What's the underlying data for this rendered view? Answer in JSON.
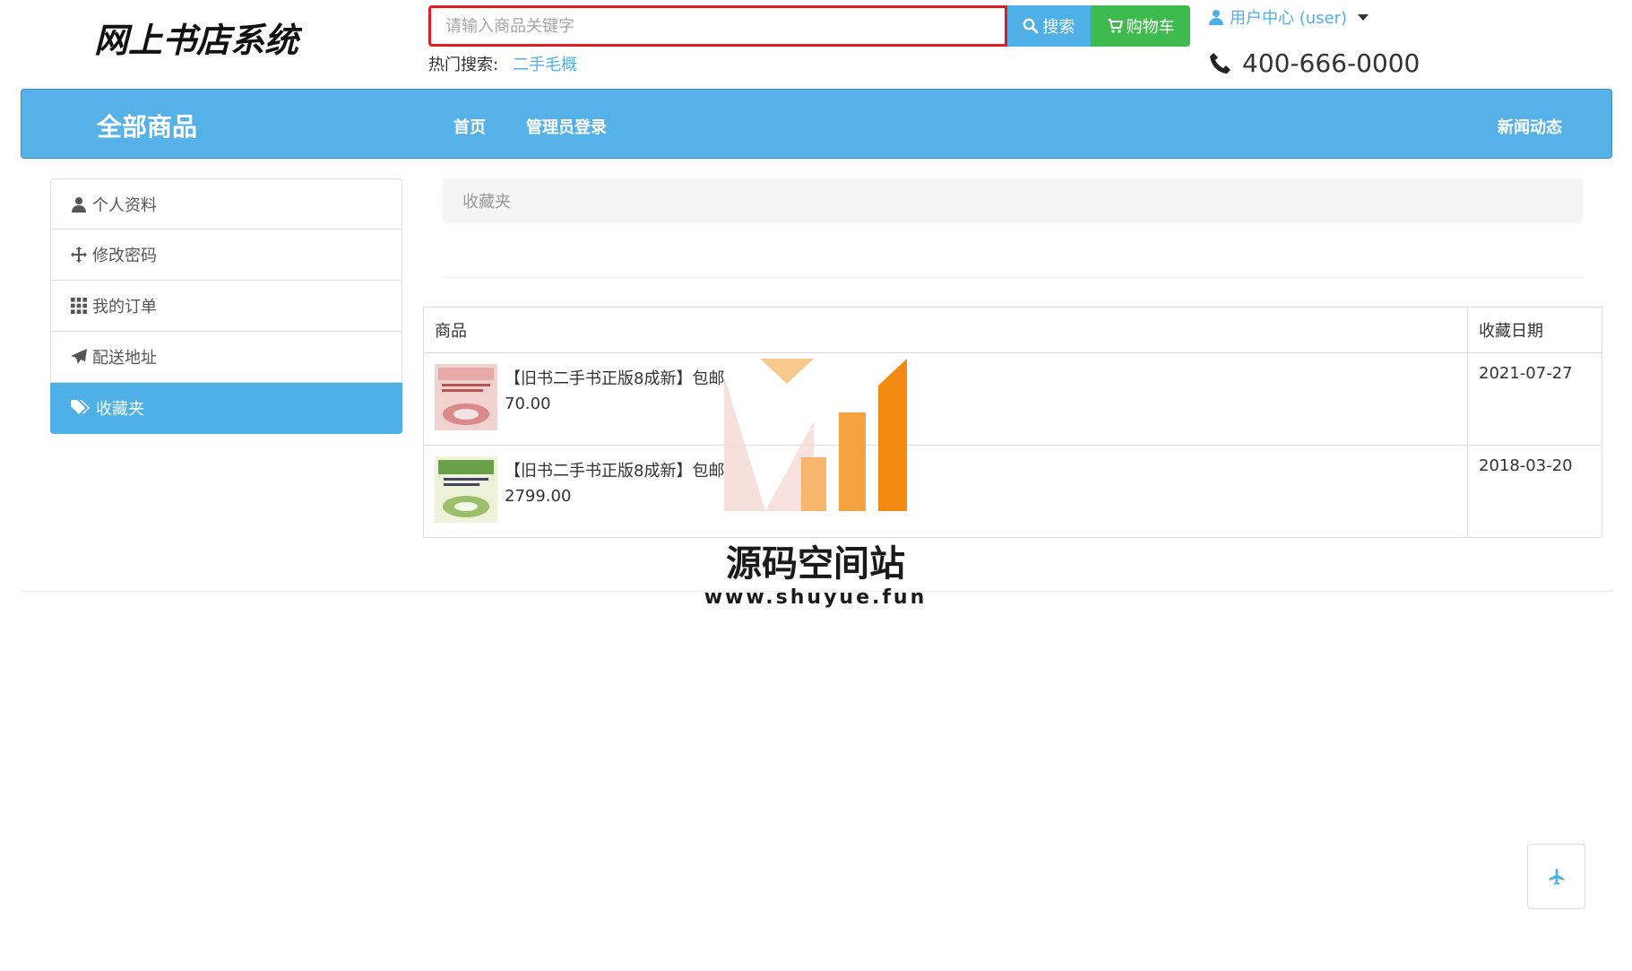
{
  "header": {
    "logo_text": "网上书店系统",
    "search": {
      "placeholder": "请输入商品关键字",
      "value": ""
    },
    "search_button": "搜索",
    "cart_button": "购物车",
    "hot_label": "热门搜索:",
    "hot_links": [
      "二手毛概"
    ],
    "user_center": "用户中心 (user)",
    "phone": "400-666-0000"
  },
  "nav": {
    "all_products": "全部商品",
    "items": [
      "首页",
      "管理员登录"
    ],
    "right_item": "新闻动态"
  },
  "sidebar": {
    "items": [
      {
        "label": "个人资料",
        "icon": "user-icon"
      },
      {
        "label": "修改密码",
        "icon": "move-icon"
      },
      {
        "label": "我的订单",
        "icon": "grid-icon"
      },
      {
        "label": "配送地址",
        "icon": "send-icon"
      },
      {
        "label": "收藏夹",
        "icon": "tags-icon",
        "active": true
      }
    ]
  },
  "main": {
    "breadcrumb": "收藏夹",
    "table": {
      "headers": [
        "商品",
        "收藏日期"
      ],
      "rows": [
        {
          "title": "【旧书二手书正版8成新】包邮",
          "price": "70.00",
          "date": "2021-07-27",
          "thumb_color": "#d98a8a"
        },
        {
          "title": "【旧书二手书正版8成新】包邮",
          "price": "2799.00",
          "date": "2018-03-20",
          "thumb_color": "#9bbf6a"
        }
      ]
    }
  },
  "watermark": {
    "title": "源码空间站",
    "url": "www.shuyue.fun"
  },
  "colors": {
    "primary": "#4fb0e8",
    "navbar": "#56b1e8",
    "cart": "#3fba4f",
    "search_border": "#e31b23",
    "watermark_orange": "#f39a2e"
  }
}
